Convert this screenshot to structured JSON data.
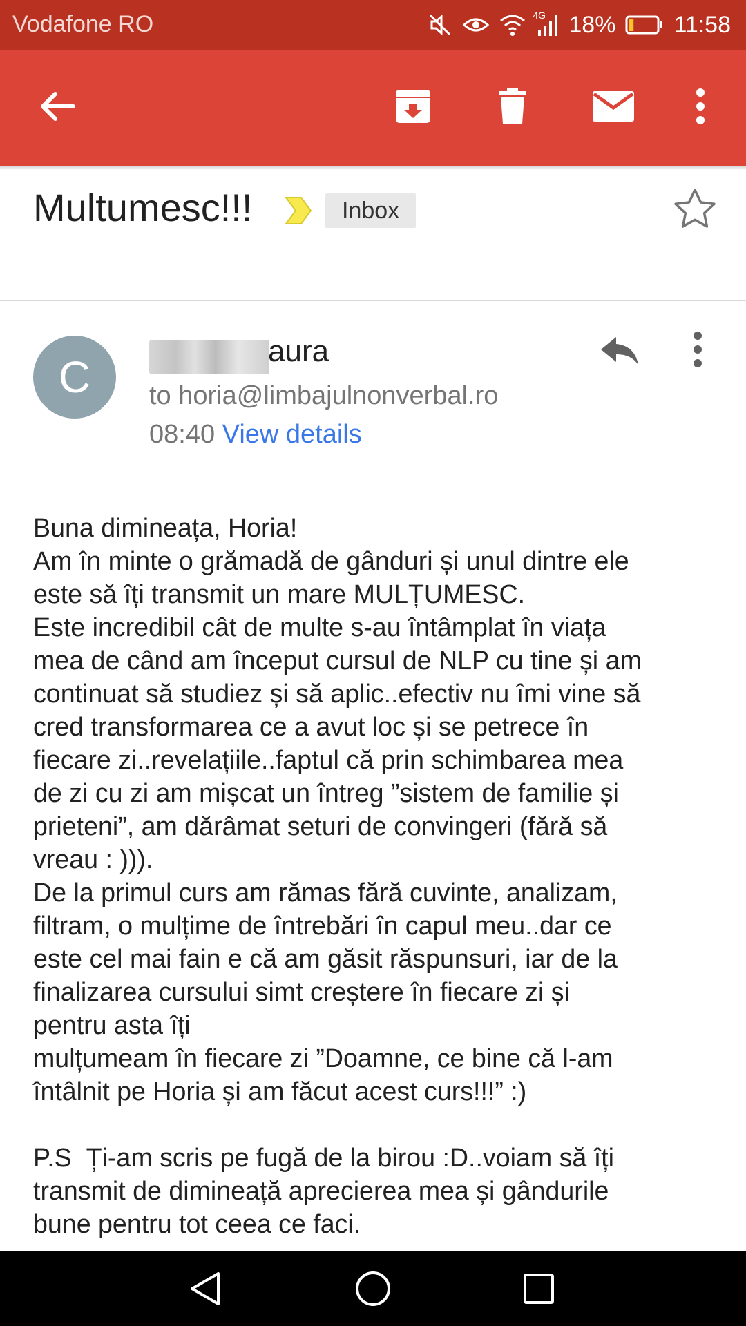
{
  "status_bar": {
    "carrier": "Vodafone RO",
    "network_badge": "4G",
    "battery_percent": "18%",
    "time": "11:58",
    "battery_level": 0.18,
    "icons": [
      "mute-icon",
      "eye-icon",
      "wifi-icon",
      "signal-icon",
      "battery-icon"
    ]
  },
  "app_bar": {
    "icons": [
      "back-arrow-icon",
      "archive-icon",
      "trash-icon",
      "mail-icon",
      "more-vert-icon"
    ],
    "color": "#db4437"
  },
  "email": {
    "subject": "Multumesc!!!",
    "label": "Inbox",
    "sender_initial": "C",
    "sender_name_visible": "aura",
    "to_line": "to horia@limbajulnonverbal.ro",
    "time": "08:40",
    "view_details": "View details",
    "body": "Buna dimineața, Horia!\nAm în minte o grămadă de gânduri și unul dintre ele\neste să îți transmit un mare MULȚUMESC.\nEste incredibil cât de multe s-au întâmplat în viața\nmea de când am început cursul de NLP cu tine și am\ncontinuat să studiez și să aplic..efectiv nu îmi vine să\ncred transformarea ce a avut loc și se petrece în\nfiecare zi..revelațiile..faptul că prin schimbarea mea\nde zi cu zi am mișcat un întreg ”sistem de familie și\nprieteni”, am dărâmat seturi de convingeri (fără să\nvreau : ))).\nDe la primul curs am rămas fără cuvinte, analizam,\nfiltram, o mulțime de întrebări în capul meu..dar ce\neste cel mai fain e că am găsit răspunsuri, iar de la\nfinalizarea cursului simt creștere în fiecare zi și\npentru asta îți\nmulțumeam în fiecare zi ”Doamne, ce bine că l-am\nîntâlnit pe Horia și am făcut acest curs!!!” :)\n\nP.S  Ți-am scris pe fugă de la birou :D..voiam să îți\ntransmit de dimineață aprecierea mea și gândurile\nbune pentru tot ceea ce faci."
  },
  "nav_bar": {
    "icons": [
      "nav-back-icon",
      "nav-home-icon",
      "nav-recents-icon"
    ]
  }
}
